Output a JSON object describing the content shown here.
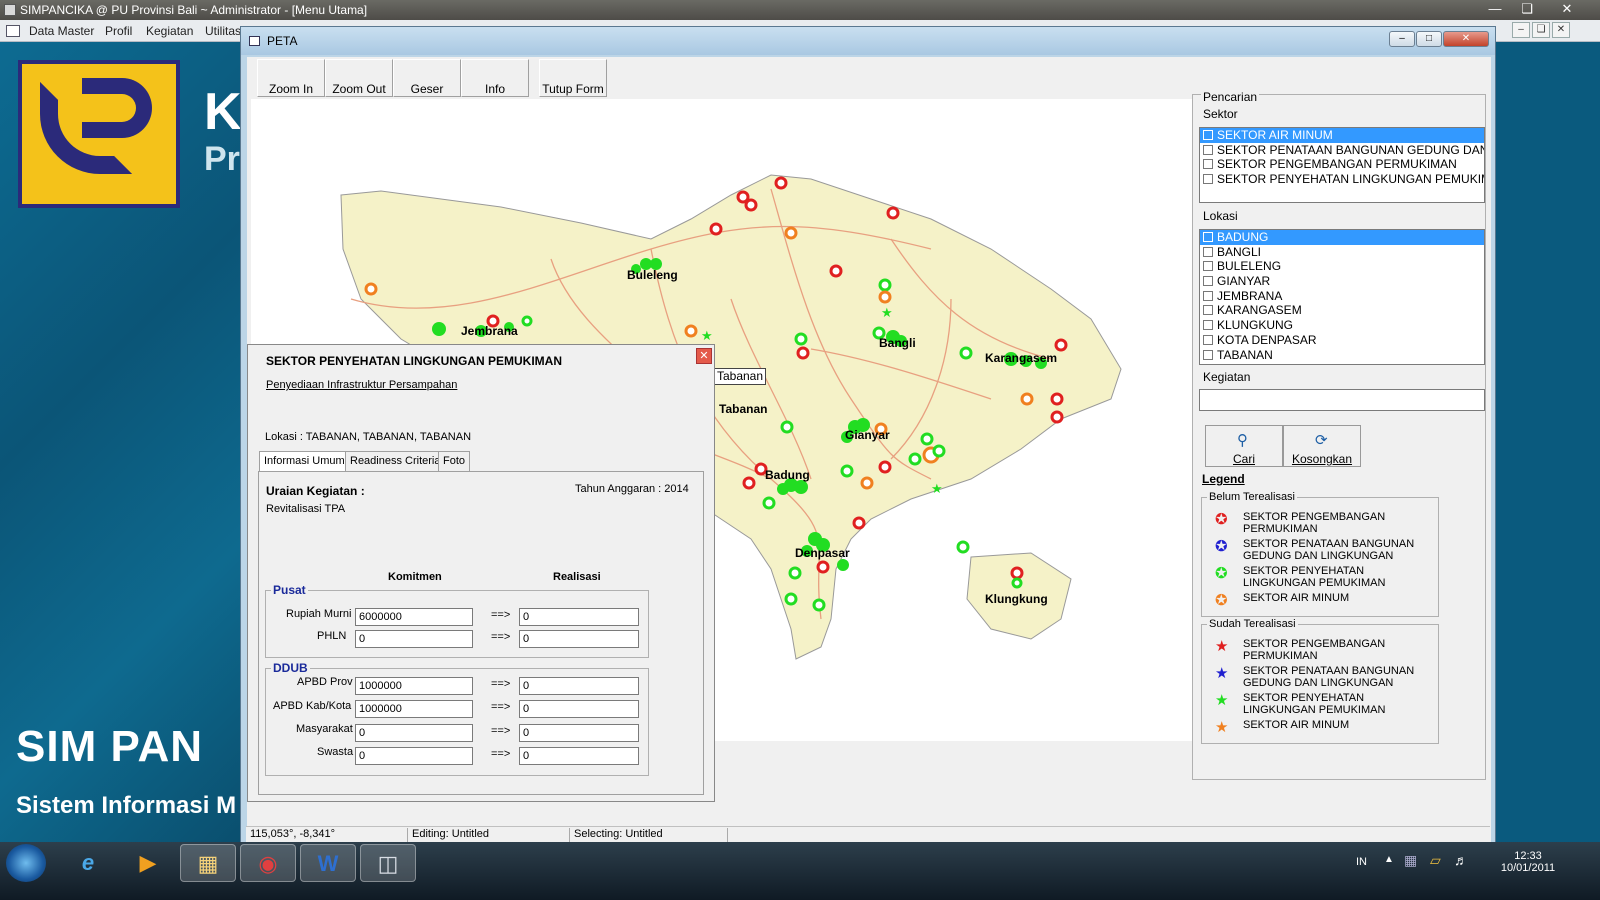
{
  "app": {
    "title": "SIMPANCIKA @ PU Provinsi Bali ~ Administrator - [Menu Utama]",
    "menu": [
      "Data Master",
      "Profil",
      "Kegiatan",
      "Utilitas"
    ],
    "bg_k": "K",
    "bg_pr": "Pr",
    "bg_sim": "SIM PAN",
    "bg_sis": "Sistem Informasi M"
  },
  "peta": {
    "title": "PETA",
    "toolbar": [
      "Zoom In",
      "Zoom Out",
      "Geser",
      "Info",
      "Tutup Form"
    ],
    "tooltip": "Tabanan",
    "places": [
      {
        "name": "Buleleng"
      },
      {
        "name": "Jembrana"
      },
      {
        "name": "Bangli"
      },
      {
        "name": "Karangasem"
      },
      {
        "name": "Tabanan"
      },
      {
        "name": "Gianyar"
      },
      {
        "name": "Badung"
      },
      {
        "name": "Denpasar"
      },
      {
        "name": "Klungkung"
      }
    ]
  },
  "info": {
    "title": "SEKTOR PENYEHATAN LINGKUNGAN PEMUKIMAN",
    "subtitle": "Penyediaan Infrastruktur Persampahan",
    "lokasi": "Lokasi : TABANAN, TABANAN, TABANAN",
    "tabs": [
      "Informasi Umum",
      "Readiness Criteria",
      "Foto"
    ],
    "uraian_label": "Uraian Kegiatan :",
    "tahun": "Tahun Anggaran : 2014",
    "uraian": "Revitalisasi TPA",
    "col_komitmen": "Komitmen",
    "col_realisasi": "Realisasi",
    "arrow": "==>",
    "pusat": {
      "title": "Pusat",
      "rows": [
        {
          "label": "Rupiah Murni",
          "komitmen": "6000000",
          "realisasi": "0"
        },
        {
          "label": "PHLN",
          "komitmen": "0",
          "realisasi": "0"
        }
      ]
    },
    "ddub": {
      "title": "DDUB",
      "rows": [
        {
          "label": "APBD Prov",
          "komitmen": "1000000",
          "realisasi": "0"
        },
        {
          "label": "APBD Kab/Kota",
          "komitmen": "1000000",
          "realisasi": "0"
        },
        {
          "label": "Masyarakat",
          "komitmen": "0",
          "realisasi": "0"
        },
        {
          "label": "Swasta",
          "komitmen": "0",
          "realisasi": "0"
        }
      ]
    }
  },
  "pencarian": {
    "title": "Pencarian",
    "sektor_label": "Sektor",
    "sektor": [
      "SEKTOR AIR MINUM",
      "SEKTOR PENATAAN BANGUNAN GEDUNG DAN LING",
      "SEKTOR PENGEMBANGAN PERMUKIMAN",
      "SEKTOR PENYEHATAN LINGKUNGAN PEMUKIMAN"
    ],
    "lokasi_label": "Lokasi",
    "lokasi": [
      "BADUNG",
      "BANGLI",
      "BULELENG",
      "GIANYAR",
      "JEMBRANA",
      "KARANGASEM",
      "KLUNGKUNG",
      "KOTA DENPASAR",
      "TABANAN"
    ],
    "kegiatan_label": "Kegiatan",
    "kegiatan_value": "",
    "btn_cari": "Cari",
    "btn_kosongkan": "Kosongkan"
  },
  "legend": {
    "title": "Legend",
    "belum_title": "Belum Terealisasi",
    "sudah_title": "Sudah Terealisasi",
    "belum": [
      {
        "l1": "SEKTOR PENGEMBANGAN",
        "l2": "PERMUKIMAN",
        "color": "#e02020"
      },
      {
        "l1": "SEKTOR PENATAAN BANGUNAN",
        "l2": "GEDUNG DAN LINGKUNGAN",
        "color": "#2020d0"
      },
      {
        "l1": "SEKTOR PENYEHATAN",
        "l2": "LINGKUNGAN PEMUKIMAN",
        "color": "#22dd22"
      },
      {
        "l1": "SEKTOR AIR MINUM",
        "l2": "",
        "color": "#f08020"
      }
    ],
    "sudah": [
      {
        "l1": "SEKTOR PENGEMBANGAN",
        "l2": "PERMUKIMAN",
        "color": "#e02020"
      },
      {
        "l1": "SEKTOR PENATAAN BANGUNAN",
        "l2": "GEDUNG DAN LINGKUNGAN",
        "color": "#2020d0"
      },
      {
        "l1": "SEKTOR PENYEHATAN",
        "l2": "LINGKUNGAN PEMUKIMAN",
        "color": "#22dd22"
      },
      {
        "l1": "SEKTOR AIR MINUM",
        "l2": "",
        "color": "#f08020"
      }
    ]
  },
  "status": {
    "coords": "115,053°, -8,341°",
    "editing": "Editing: Untitled",
    "selecting": "Selecting: Untitled"
  },
  "taskbar": {
    "lang": "IN",
    "time": "12:33",
    "date": "10/01/2011"
  }
}
